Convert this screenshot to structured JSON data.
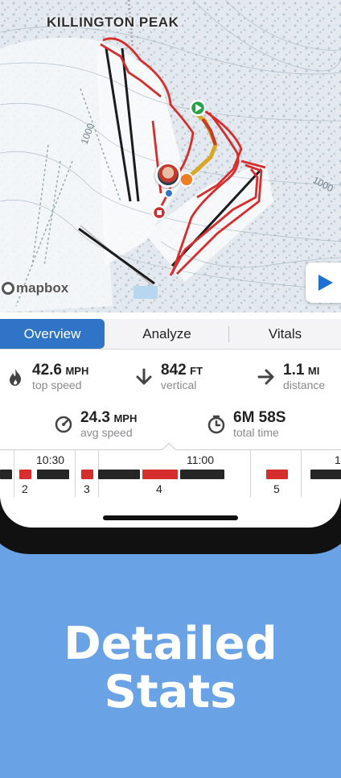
{
  "map": {
    "peak_label": "KILLINGTON PEAK",
    "contour_label_1": "1000",
    "contour_label_2": "1000",
    "attribution": "mapbox",
    "play_icon": "play-icon"
  },
  "tabs": [
    {
      "label": "Overview"
    },
    {
      "label": "Analyze"
    },
    {
      "label": "Vitals"
    }
  ],
  "stats": {
    "top_speed": {
      "value": "42.6",
      "unit": "MPH",
      "label": "top speed",
      "icon": "flame-icon"
    },
    "vertical": {
      "value": "842",
      "unit": "FT",
      "label": "vertical",
      "icon": "arrow-down-icon"
    },
    "distance": {
      "value": "1.1",
      "unit": "MI",
      "label": "distance",
      "icon": "arrow-right-icon"
    },
    "avg_speed": {
      "value": "24.3",
      "unit": "MPH",
      "label": "avg speed",
      "icon": "speedometer-icon"
    },
    "total_time": {
      "value": "6M 58S",
      "label": "total time",
      "icon": "stopwatch-icon"
    }
  },
  "timeline": {
    "times": [
      "10:30",
      "11:00",
      "1"
    ],
    "runs": [
      "2",
      "3",
      "4",
      "5"
    ]
  },
  "colors": {
    "accent": "#2f74c6",
    "track": "#d62d2d",
    "lift": "#222222",
    "promo_bg": "#6aa2e6"
  },
  "promo": {
    "line1": "Detailed",
    "line2": "Stats"
  }
}
